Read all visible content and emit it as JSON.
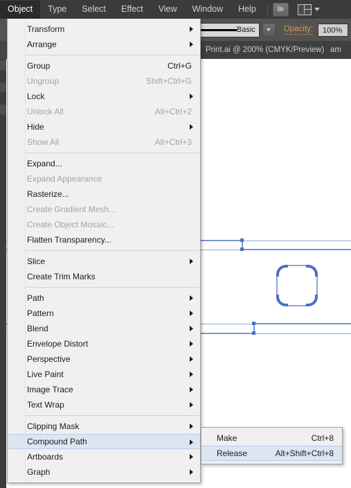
{
  "menubar": {
    "items": [
      {
        "label": "Object",
        "active": true
      },
      {
        "label": "Type",
        "active": false
      },
      {
        "label": "Select",
        "active": false
      },
      {
        "label": "Effect",
        "active": false
      },
      {
        "label": "View",
        "active": false
      },
      {
        "label": "Window",
        "active": false
      },
      {
        "label": "Help",
        "active": false
      }
    ],
    "bridge_button": "Br",
    "arrange_documents_icon": "arrange-documents-icon"
  },
  "controlbar": {
    "stroke_profile": "Basic",
    "opacity_label": "Opacity:",
    "opacity_value": "100%"
  },
  "tabbar": {
    "tabs": [
      {
        "title": "Print.ai @ 200% (CMYK/Preview)",
        "close": "×",
        "active": true
      },
      {
        "title": "am",
        "close": "",
        "active": false
      }
    ]
  },
  "object_menu": {
    "title": "Object",
    "groups": [
      {
        "items": [
          {
            "label": "Transform",
            "shortcut": "",
            "submenu": true,
            "disabled": false,
            "highlight": false
          },
          {
            "label": "Arrange",
            "shortcut": "",
            "submenu": true,
            "disabled": false,
            "highlight": false
          }
        ]
      },
      {
        "items": [
          {
            "label": "Group",
            "shortcut": "Ctrl+G",
            "submenu": false,
            "disabled": false,
            "highlight": false
          },
          {
            "label": "Ungroup",
            "shortcut": "Shift+Ctrl+G",
            "submenu": false,
            "disabled": true,
            "highlight": false
          },
          {
            "label": "Lock",
            "shortcut": "",
            "submenu": true,
            "disabled": false,
            "highlight": false
          },
          {
            "label": "Unlock All",
            "shortcut": "Alt+Ctrl+2",
            "submenu": false,
            "disabled": true,
            "highlight": false
          },
          {
            "label": "Hide",
            "shortcut": "",
            "submenu": true,
            "disabled": false,
            "highlight": false
          },
          {
            "label": "Show All",
            "shortcut": "Alt+Ctrl+3",
            "submenu": false,
            "disabled": true,
            "highlight": false
          }
        ]
      },
      {
        "items": [
          {
            "label": "Expand...",
            "shortcut": "",
            "submenu": false,
            "disabled": false,
            "highlight": false
          },
          {
            "label": "Expand Appearance",
            "shortcut": "",
            "submenu": false,
            "disabled": true,
            "highlight": false
          },
          {
            "label": "Rasterize...",
            "shortcut": "",
            "submenu": false,
            "disabled": false,
            "highlight": false
          },
          {
            "label": "Create Gradient Mesh...",
            "shortcut": "",
            "submenu": false,
            "disabled": true,
            "highlight": false
          },
          {
            "label": "Create Object Mosaic...",
            "shortcut": "",
            "submenu": false,
            "disabled": true,
            "highlight": false
          },
          {
            "label": "Flatten Transparency...",
            "shortcut": "",
            "submenu": false,
            "disabled": false,
            "highlight": false
          }
        ]
      },
      {
        "items": [
          {
            "label": "Slice",
            "shortcut": "",
            "submenu": true,
            "disabled": false,
            "highlight": false
          },
          {
            "label": "Create Trim Marks",
            "shortcut": "",
            "submenu": false,
            "disabled": false,
            "highlight": false
          }
        ]
      },
      {
        "items": [
          {
            "label": "Path",
            "shortcut": "",
            "submenu": true,
            "disabled": false,
            "highlight": false
          },
          {
            "label": "Pattern",
            "shortcut": "",
            "submenu": true,
            "disabled": false,
            "highlight": false
          },
          {
            "label": "Blend",
            "shortcut": "",
            "submenu": true,
            "disabled": false,
            "highlight": false
          },
          {
            "label": "Envelope Distort",
            "shortcut": "",
            "submenu": true,
            "disabled": false,
            "highlight": false
          },
          {
            "label": "Perspective",
            "shortcut": "",
            "submenu": true,
            "disabled": false,
            "highlight": false
          },
          {
            "label": "Live Paint",
            "shortcut": "",
            "submenu": true,
            "disabled": false,
            "highlight": false
          },
          {
            "label": "Image Trace",
            "shortcut": "",
            "submenu": true,
            "disabled": false,
            "highlight": false
          },
          {
            "label": "Text Wrap",
            "shortcut": "",
            "submenu": true,
            "disabled": false,
            "highlight": false
          }
        ]
      },
      {
        "items": [
          {
            "label": "Clipping Mask",
            "shortcut": "",
            "submenu": true,
            "disabled": false,
            "highlight": false
          },
          {
            "label": "Compound Path",
            "shortcut": "",
            "submenu": true,
            "disabled": false,
            "highlight": true
          },
          {
            "label": "Artboards",
            "shortcut": "",
            "submenu": true,
            "disabled": false,
            "highlight": false
          },
          {
            "label": "Graph",
            "shortcut": "",
            "submenu": true,
            "disabled": false,
            "highlight": false
          }
        ]
      }
    ]
  },
  "compound_path_submenu": {
    "items": [
      {
        "label": "Make",
        "shortcut": "Ctrl+8",
        "highlight": false
      },
      {
        "label": "Release",
        "shortcut": "Alt+Shift+Ctrl+8",
        "highlight": true
      }
    ]
  },
  "colors": {
    "chrome_dark": "#3b3b3b",
    "control_bar": "#535353",
    "menu_bg": "#f0f0f0",
    "menu_highlight": "#dce6f2",
    "selection_blue": "#4a6fc4",
    "guide_blue": "#8fa6d4",
    "opacity_orange": "#d99a4e"
  }
}
